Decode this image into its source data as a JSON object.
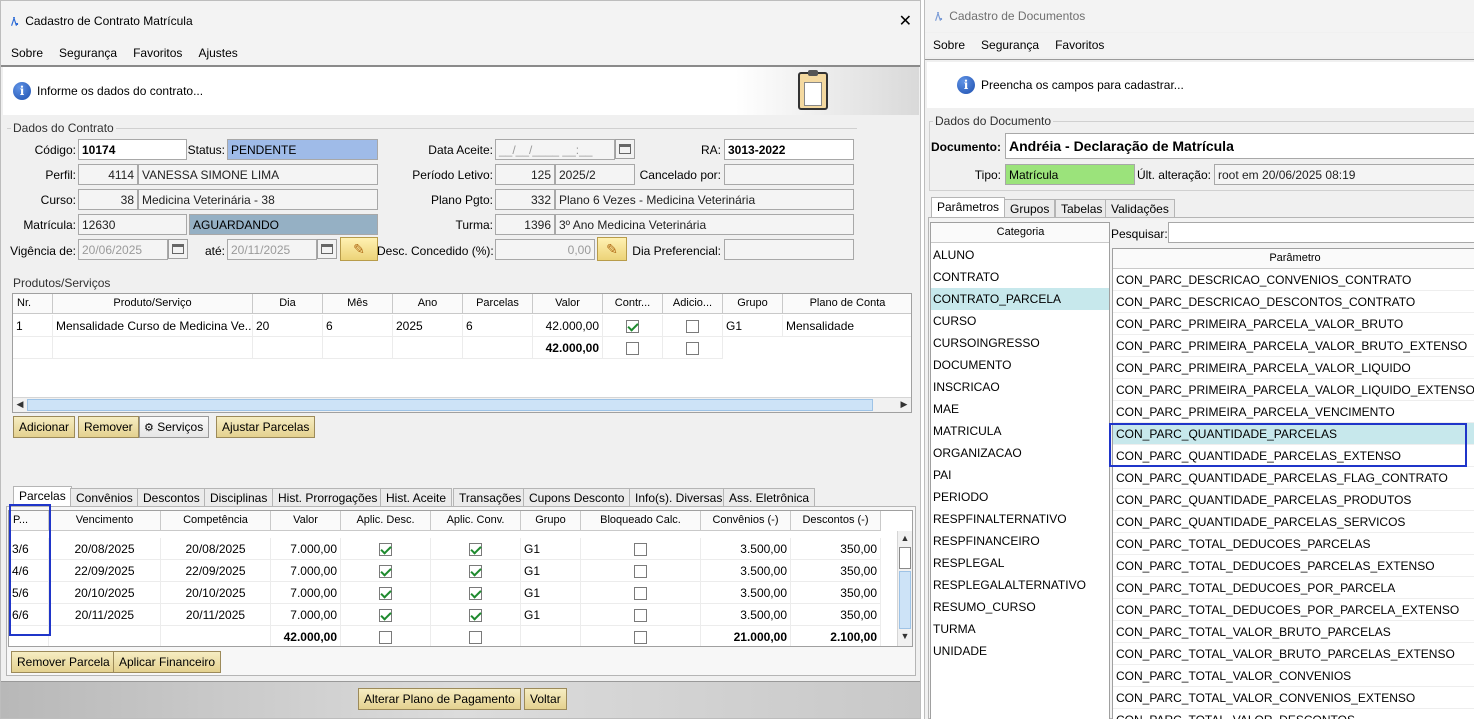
{
  "left_window": {
    "logo": "/\\.",
    "title": "Cadastro de Contrato Matrícula",
    "close_glyph": "✕",
    "menu": [
      "Sobre",
      "Segurança",
      "Favoritos",
      "Ajustes"
    ],
    "info_text": "Informe os dados do contrato...",
    "dados_contrato": {
      "title": "Dados do Contrato",
      "codigo_label": "Código:",
      "codigo": "10174",
      "status_label": "Status:",
      "status": "PENDENTE",
      "data_aceite_label": "Data Aceite:",
      "data_aceite": "__/__/____ __:__",
      "ra_label": "RA:",
      "ra": "3013-2022",
      "perfil_label": "Perfil:",
      "perfil_id": "4114",
      "perfil_nome": "VANESSA SIMONE LIMA",
      "periodo_label": "Período Letivo:",
      "periodo_id": "125",
      "periodo": "2025/2",
      "cancelado_label": "Cancelado por:",
      "cancelado": "",
      "curso_label": "Curso:",
      "curso_id": "38",
      "curso_nome": "Medicina Veterinária - 38",
      "plano_label": "Plano Pgto:",
      "plano_id": "332",
      "plano_nome": "Plano 6 Vezes - Medicina Veterinária",
      "matricula_label": "Matrícula:",
      "matricula": "12630",
      "matricula_status": "AGUARDANDO",
      "turma_label": "Turma:",
      "turma_id": "1396",
      "turma_nome": "3º Ano Medicina Veterinária",
      "vigencia_label": "Vigência de:",
      "vigencia_de": "20/06/2025",
      "ate_label": "até:",
      "vigencia_ate": "20/11/2025",
      "desc_label": "Desc. Concedido (%):",
      "desc": "0,00",
      "dia_pref_label": "Dia Preferencial:",
      "dia_pref": ""
    },
    "produtos": {
      "title": "Produtos/Serviços",
      "headers": [
        "Nr.",
        "Produto/Serviço",
        "Dia",
        "Mês",
        "Ano",
        "Parcelas",
        "Valor",
        "Contr...",
        "Adicio...",
        "Grupo",
        "Plano de Conta"
      ],
      "row": {
        "nr": "1",
        "produto": "Mensalidade Curso de Medicina Ve...",
        "dia": "20",
        "mes": "6",
        "ano": "2025",
        "parcelas": "6",
        "valor": "42.000,00",
        "grupo": "G1",
        "plano": "Mensalidade"
      },
      "total": "42.000,00",
      "buttons": [
        "Adicionar",
        "Remover",
        "Serviços",
        "Ajustar Parcelas"
      ]
    },
    "tabs": [
      "Parcelas",
      "Convênios",
      "Descontos",
      "Disciplinas",
      "Hist. Prorrogações",
      "Hist. Aceite",
      "Transações",
      "Cupons Desconto",
      "Info(s). Diversas",
      "Ass. Eletrônica"
    ],
    "parcelas": {
      "headers": [
        "P...",
        "Vencimento",
        "Competência",
        "Valor",
        "Aplic. Desc.",
        "Aplic. Conv.",
        "Grupo",
        "Bloqueado Calc.",
        "Convênios (-)",
        "Descontos (-)"
      ],
      "rows": [
        {
          "p": "3/6",
          "venc": "20/08/2025",
          "comp": "20/08/2025",
          "valor": "7.000,00",
          "grupo": "G1",
          "conv": "3.500,00",
          "desc": "350,00"
        },
        {
          "p": "4/6",
          "venc": "22/09/2025",
          "comp": "22/09/2025",
          "valor": "7.000,00",
          "grupo": "G1",
          "conv": "3.500,00",
          "desc": "350,00"
        },
        {
          "p": "5/6",
          "venc": "20/10/2025",
          "comp": "20/10/2025",
          "valor": "7.000,00",
          "grupo": "G1",
          "conv": "3.500,00",
          "desc": "350,00"
        },
        {
          "p": "6/6",
          "venc": "20/11/2025",
          "comp": "20/11/2025",
          "valor": "7.000,00",
          "grupo": "G1",
          "conv": "3.500,00",
          "desc": "350,00"
        }
      ],
      "total_valor": "42.000,00",
      "total_conv": "21.000,00",
      "total_desc": "2.100,00",
      "buttons": [
        "Remover Parcela",
        "Aplicar Financeiro"
      ]
    },
    "footer_buttons": [
      "Alterar Plano de Pagamento",
      "Voltar"
    ]
  },
  "right_window": {
    "logo": "/\\.",
    "title": "Cadastro de Documentos",
    "menu": [
      "Sobre",
      "Segurança",
      "Favoritos"
    ],
    "info_text": "Preencha os campos para cadastrar...",
    "dados_documento": {
      "title": "Dados do Documento",
      "documento_label": "Documento:",
      "documento": "Andréia - Declaração de Matrícula",
      "tipo_label": "Tipo:",
      "tipo": "Matrícula",
      "ult_alt_label": "Últ. alteração:",
      "ult_alt": "root em 20/06/2025 08:19"
    },
    "tabs": [
      "Parâmetros",
      "Grupos",
      "Tabelas",
      "Validações"
    ],
    "categoria_header": "Categoria",
    "categorias": [
      "ALUNO",
      "CONTRATO",
      "CONTRATO_PARCELA",
      "CURSO",
      "CURSOINGRESSO",
      "DOCUMENTO",
      "INSCRICAO",
      "MAE",
      "MATRICULA",
      "ORGANIZACAO",
      "PAI",
      "PERIODO",
      "RESPFINALTERNATIVO",
      "RESPFINANCEIRO",
      "RESPLEGAL",
      "RESPLEGALALTERNATIVO",
      "RESUMO_CURSO",
      "TURMA",
      "UNIDADE"
    ],
    "pesquisar_label": "Pesquisar:",
    "parametro_header": "Parâmetro",
    "parametros": [
      "CON_PARC_DESCRICAO_CONVENIOS_CONTRATO",
      "CON_PARC_DESCRICAO_DESCONTOS_CONTRATO",
      "CON_PARC_PRIMEIRA_PARCELA_VALOR_BRUTO",
      "CON_PARC_PRIMEIRA_PARCELA_VALOR_BRUTO_EXTENSO",
      "CON_PARC_PRIMEIRA_PARCELA_VALOR_LIQUIDO",
      "CON_PARC_PRIMEIRA_PARCELA_VALOR_LIQUIDO_EXTENSO",
      "CON_PARC_PRIMEIRA_PARCELA_VENCIMENTO",
      "CON_PARC_QUANTIDADE_PARCELAS",
      "CON_PARC_QUANTIDADE_PARCELAS_EXTENSO",
      "CON_PARC_QUANTIDADE_PARCELAS_FLAG_CONTRATO",
      "CON_PARC_QUANTIDADE_PARCELAS_PRODUTOS",
      "CON_PARC_QUANTIDADE_PARCELAS_SERVICOS",
      "CON_PARC_TOTAL_DEDUCOES_PARCELAS",
      "CON_PARC_TOTAL_DEDUCOES_PARCELAS_EXTENSO",
      "CON_PARC_TOTAL_DEDUCOES_POR_PARCELA",
      "CON_PARC_TOTAL_DEDUCOES_POR_PARCELA_EXTENSO",
      "CON_PARC_TOTAL_VALOR_BRUTO_PARCELAS",
      "CON_PARC_TOTAL_VALOR_BRUTO_PARCELAS_EXTENSO",
      "CON_PARC_TOTAL_VALOR_CONVENIOS",
      "CON_PARC_TOTAL_VALOR_CONVENIOS_EXTENSO",
      "CON_PARC_TOTAL_VALOR_DESCONTOS"
    ]
  }
}
